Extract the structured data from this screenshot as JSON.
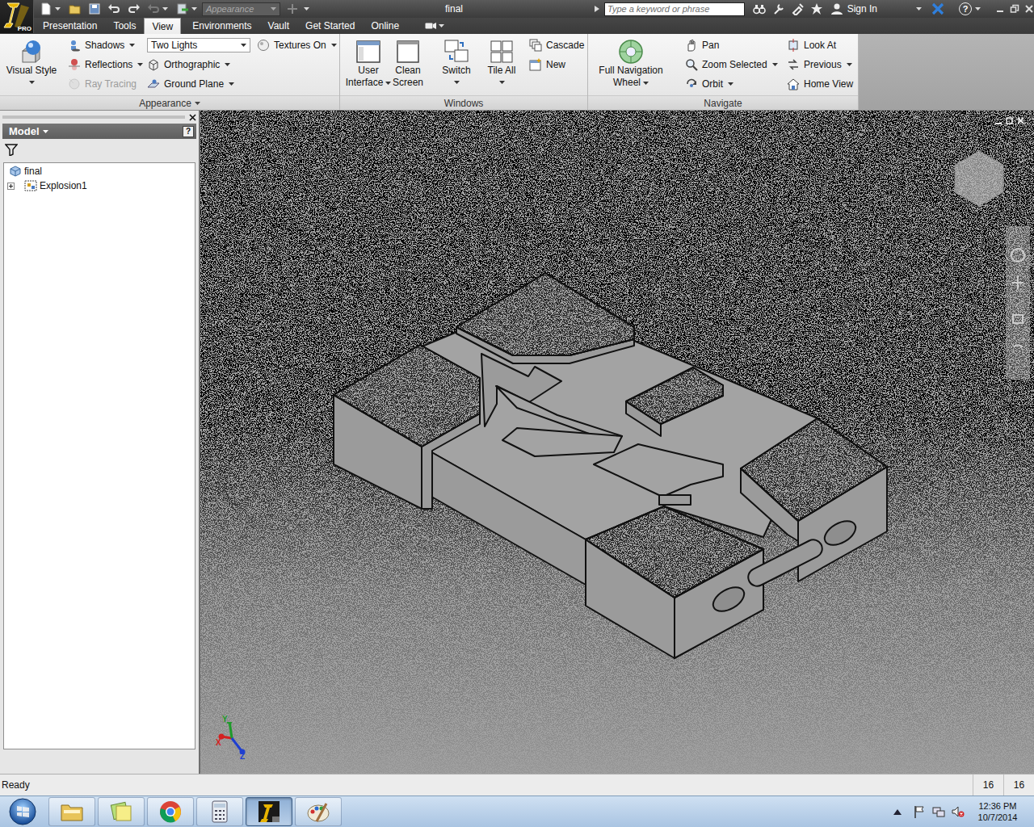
{
  "window": {
    "logo_badge": "PRO",
    "appearance_field": "Appearance",
    "title": "final",
    "search_placeholder": "Type a keyword or phrase",
    "sign_in": "Sign In",
    "help": "?"
  },
  "ribbon_tabs": [
    {
      "label": "Presentation",
      "selected": false
    },
    {
      "label": "Tools",
      "selected": false
    },
    {
      "label": "View",
      "selected": true
    },
    {
      "label": "Environments",
      "selected": false
    },
    {
      "label": "Vault",
      "selected": false
    },
    {
      "label": "Get Started",
      "selected": false
    },
    {
      "label": "Online",
      "selected": false
    }
  ],
  "ribbon_panels": [
    {
      "title": "Appearance",
      "dropdown": true,
      "groups": [
        {
          "kind": "large",
          "items": [
            {
              "lines": [
                "Visual Style"
              ],
              "dropdown": true
            }
          ]
        },
        {
          "kind": "small",
          "items": [
            {
              "label": "Shadows",
              "kind": "button",
              "dropdown": true,
              "disabled": false
            },
            {
              "label": "Reflections",
              "kind": "button",
              "dropdown": true,
              "disabled": false
            },
            {
              "label": "Ray Tracing",
              "kind": "button",
              "dropdown": false,
              "disabled": true
            }
          ]
        },
        {
          "kind": "small",
          "items": [
            {
              "label": "Two Lights",
              "kind": "combo",
              "dropdown": true,
              "disabled": false
            },
            {
              "label": "Orthographic",
              "kind": "button",
              "dropdown": true,
              "disabled": false
            },
            {
              "label": "Ground Plane",
              "kind": "button",
              "dropdown": true,
              "disabled": false
            }
          ]
        },
        {
          "kind": "small",
          "items": [
            {
              "label": "Textures On",
              "kind": "button",
              "dropdown": true,
              "disabled": false
            }
          ]
        }
      ]
    },
    {
      "title": "Windows",
      "dropdown": false,
      "groups": [
        {
          "kind": "large",
          "items": [
            {
              "lines": [
                "User",
                "Interface"
              ],
              "dropdown": true
            },
            {
              "lines": [
                "Clean",
                "Screen"
              ],
              "dropdown": false
            },
            {
              "lines": [
                "Switch"
              ],
              "dropdown": true
            },
            {
              "lines": [
                "Tile All"
              ],
              "dropdown": true
            }
          ]
        },
        {
          "kind": "small",
          "items": [
            {
              "label": "Cascade",
              "kind": "button",
              "dropdown": false,
              "disabled": false
            },
            {
              "label": "New",
              "kind": "button",
              "dropdown": false,
              "disabled": false
            }
          ]
        }
      ]
    },
    {
      "title": "Navigate",
      "dropdown": false,
      "groups": [
        {
          "kind": "large",
          "items": [
            {
              "lines": [
                "Full Navigation",
                "Wheel"
              ],
              "dropdown": true
            }
          ]
        },
        {
          "kind": "small",
          "items": [
            {
              "label": "Pan",
              "kind": "button",
              "dropdown": false,
              "disabled": false
            },
            {
              "label": "Zoom Selected",
              "kind": "button",
              "dropdown": true,
              "disabled": false
            },
            {
              "label": "Orbit",
              "kind": "button",
              "dropdown": true,
              "disabled": false
            }
          ]
        },
        {
          "kind": "small",
          "items": [
            {
              "label": "Look At",
              "kind": "button",
              "dropdown": false,
              "disabled": false
            },
            {
              "label": "Previous",
              "kind": "button",
              "dropdown": true,
              "disabled": false
            },
            {
              "label": "Home View",
              "kind": "button",
              "dropdown": false,
              "disabled": false
            }
          ]
        }
      ]
    }
  ],
  "browser": {
    "title": "Model",
    "help": "?",
    "tree": [
      {
        "label": "final",
        "expandable": false,
        "expanded": false
      },
      {
        "label": "Explosion1",
        "expandable": true,
        "expanded": false
      }
    ]
  },
  "viewport": {
    "axes": [
      {
        "label": "X",
        "color": "#d42020"
      },
      {
        "label": "Y",
        "color": "#1f9a2a"
      },
      {
        "label": "Z",
        "color": "#1f3fd0"
      }
    ]
  },
  "status_bar": {
    "message": "Ready",
    "fields": [
      "16",
      "16"
    ]
  },
  "taskbar": {
    "apps": [
      {
        "active": false
      },
      {
        "active": false
      },
      {
        "active": false
      },
      {
        "active": false
      },
      {
        "active": true
      },
      {
        "active": false
      }
    ],
    "time": "12:36 PM",
    "date": "10/7/2014"
  }
}
